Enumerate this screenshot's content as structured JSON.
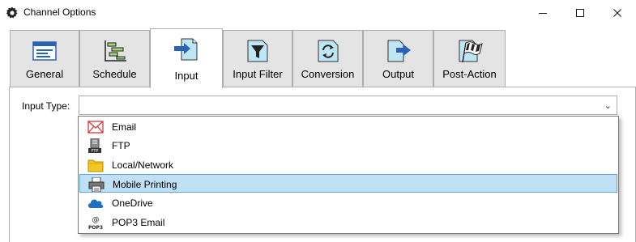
{
  "window": {
    "title": "Channel Options",
    "icon": "gear-icon"
  },
  "tabs": [
    {
      "label": "General",
      "icon": "window-icon",
      "active": false
    },
    {
      "label": "Schedule",
      "icon": "schedule-icon",
      "active": false
    },
    {
      "label": "Input",
      "icon": "input-arrow-icon",
      "active": true
    },
    {
      "label": "Input Filter",
      "icon": "filter-icon",
      "active": false
    },
    {
      "label": "Conversion",
      "icon": "conversion-icon",
      "active": false
    },
    {
      "label": "Output",
      "icon": "output-arrow-icon",
      "active": false
    },
    {
      "label": "Post-Action",
      "icon": "checkered-flag-icon",
      "active": false
    }
  ],
  "input": {
    "label": "Input Type:",
    "value": "",
    "options": [
      {
        "label": "Email",
        "icon": "envelope-icon",
        "selected": false
      },
      {
        "label": "FTP",
        "icon": "ftp-server-icon",
        "selected": false
      },
      {
        "label": "Local/Network",
        "icon": "folder-icon",
        "selected": false
      },
      {
        "label": "Mobile Printing",
        "icon": "printer-icon",
        "selected": true
      },
      {
        "label": "OneDrive",
        "icon": "onedrive-cloud-icon",
        "selected": false
      },
      {
        "label": "POP3 Email",
        "icon": "pop3-icon",
        "selected": false
      }
    ]
  },
  "colors": {
    "selection": "#bfe0f5",
    "selection_border": "#5aa6d8",
    "tab_inactive": "#e4e4e4",
    "accent_blue": "#2a62b8"
  }
}
